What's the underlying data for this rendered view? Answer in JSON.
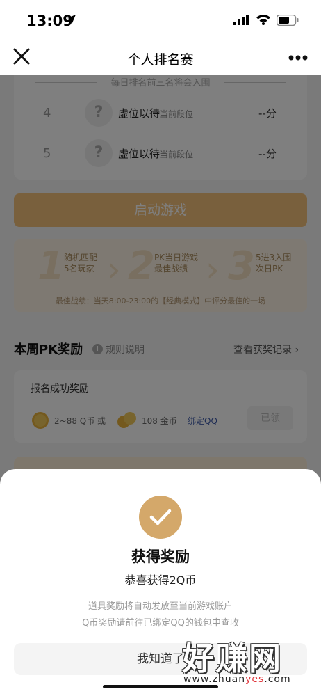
{
  "status_bar": {
    "time": "13:09"
  },
  "nav": {
    "title": "个人排名赛"
  },
  "ranking": {
    "header": "每日排名前三名将会入围",
    "rows": [
      {
        "rank": "4",
        "placeholder": "?",
        "name": "虚位以待",
        "tag": "当前段位",
        "score": "--分"
      },
      {
        "rank": "5",
        "placeholder": "?",
        "name": "虚位以待",
        "tag": "当前段位",
        "score": "--分"
      }
    ]
  },
  "start_button": "启动游戏",
  "steps": {
    "items": [
      {
        "num": "1",
        "line1": "随机匹配",
        "line2": "5名玩家"
      },
      {
        "num": "2",
        "line1": "PK当日游戏",
        "line2": "最佳战绩"
      },
      {
        "num": "3",
        "line1": "5进3入围",
        "line2": "次日PK"
      }
    ],
    "note": "最佳战绩：当天8:00-23:00的【经典模式】中评分最佳的一场"
  },
  "weekly_reward": {
    "title": "本周PK奖励",
    "rules_link": "规则说明",
    "records_link": "查看获奖记录 ›",
    "card": {
      "heading": "报名成功奖励",
      "qcoin_text": "2~88 Q币 或",
      "gold_text": "108 金币",
      "bind_text": "绑定QQ",
      "claimed_label": "已领"
    }
  },
  "dialog": {
    "title": "获得奖励",
    "subtitle": "恭喜获得2Q币",
    "desc1": "道具奖励将自动发放至当前游戏账户",
    "desc2": "Q币奖励请前往已绑定QQ的钱包中查收",
    "button": "我知道了"
  },
  "watermark": {
    "big": "好赚网",
    "small_a": "www.zhuan",
    "small_b": "yes",
    "small_c": ".com"
  }
}
